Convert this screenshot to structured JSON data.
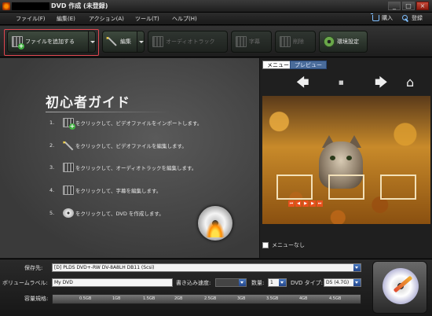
{
  "window": {
    "title": "DVD 作成 (未登録)",
    "controls": [
      "_",
      "□",
      "×"
    ]
  },
  "menu": {
    "items": [
      "ファイル(F)",
      "編集(E)",
      "アクション(A)",
      "ツール(T)",
      "ヘルプ(H)"
    ],
    "buy": "購入",
    "register": "登録"
  },
  "toolbar": {
    "add_file": "ファイルを追加する",
    "edit": "編集",
    "audio_track": "オーディオトラック",
    "subtitle": "字幕",
    "delete": "削除",
    "settings": "環境設定"
  },
  "guide": {
    "title": "初心者ガイド",
    "steps": [
      {
        "num": "1.",
        "text": "をクリックして、ビデオファイルをインポートします。",
        "icon": "add-file-icon"
      },
      {
        "num": "2.",
        "text": "をクリックして、ビデオファイルを編集します。",
        "icon": "magic-wand-icon"
      },
      {
        "num": "3.",
        "text": "をクリックして、オーディオトラックを編集します。",
        "icon": "audio-track-icon"
      },
      {
        "num": "4.",
        "text": "をクリックして、字幕を編集します。",
        "icon": "subtitle-icon"
      },
      {
        "num": "5.",
        "text": "をクリックして、DVD を作成します。",
        "icon": "dvd-disc-icon"
      }
    ]
  },
  "preview": {
    "tab_menu": "メニュー",
    "tab_preview": "プレビュー",
    "nav_mid": "■",
    "no_menu": "メニューなし"
  },
  "settings": {
    "save_to_label": "保存先:",
    "save_to_value": "[D] PLDS DVD+-RW DV-8A8LH DB11 (Scsi)",
    "volume_label": "ボリュームラベル:",
    "volume_value": "My DVD",
    "write_speed_label": "書き込み速度:",
    "write_speed_value": "",
    "copies_label": "数量:",
    "copies_value": "1",
    "dvd_type_label": "DVD タイプ:",
    "dvd_type_value": "D5 (4.7G)",
    "capacity_label": "容量規格:",
    "capacity_ticks": [
      "0.5GB",
      "1GB",
      "1.5GB",
      "2GB",
      "2.5GB",
      "3GB",
      "3.5GB",
      "4GB",
      "4.5GB"
    ]
  }
}
